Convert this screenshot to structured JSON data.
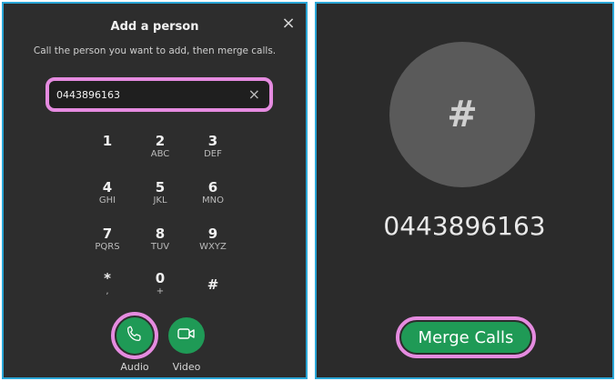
{
  "dialog": {
    "title": "Add a person",
    "subtitle": "Call the person you want to add, then merge calls.",
    "input_value": "0443896163"
  },
  "keypad": [
    {
      "digit": "1",
      "letters": ""
    },
    {
      "digit": "2",
      "letters": "ABC"
    },
    {
      "digit": "3",
      "letters": "DEF"
    },
    {
      "digit": "4",
      "letters": "GHI"
    },
    {
      "digit": "5",
      "letters": "JKL"
    },
    {
      "digit": "6",
      "letters": "MNO"
    },
    {
      "digit": "7",
      "letters": "PQRS"
    },
    {
      "digit": "8",
      "letters": "TUV"
    },
    {
      "digit": "9",
      "letters": "WXYZ"
    },
    {
      "digit": "*",
      "letters": ","
    },
    {
      "digit": "0",
      "letters": "+"
    },
    {
      "digit": "#",
      "letters": ""
    }
  ],
  "actions": {
    "audio_label": "Audio",
    "video_label": "Video"
  },
  "call": {
    "avatar_symbol": "#",
    "number": "0443896163",
    "merge_label": "Merge Calls"
  },
  "colors": {
    "accent_green": "#1f9a56",
    "highlight": "#e58be0",
    "border": "#2aa6d6"
  },
  "icons": {
    "close": "close-icon",
    "clear": "clear-icon",
    "audio": "phone-icon",
    "video": "video-camera-icon"
  }
}
